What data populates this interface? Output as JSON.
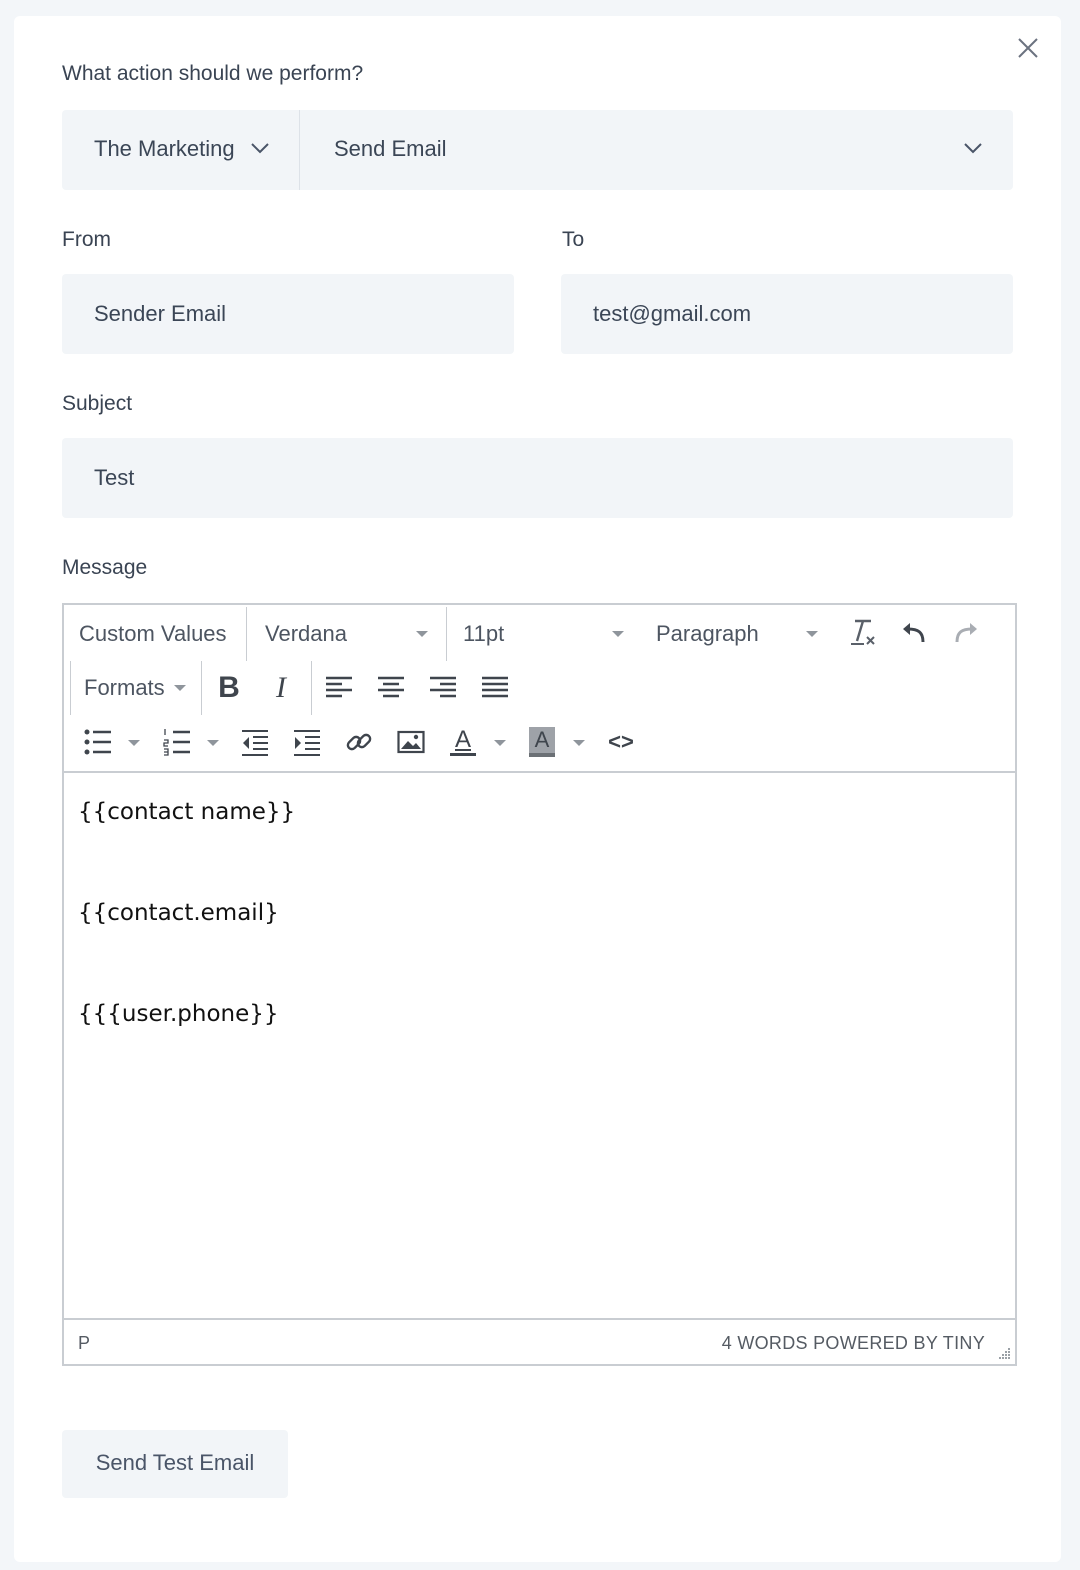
{
  "question": "What action should we perform?",
  "action": {
    "app_label": "The Marketing",
    "type_label": "Send Email"
  },
  "from": {
    "label": "From",
    "value": "Sender Email"
  },
  "to": {
    "label": "To",
    "value": "test@gmail.com"
  },
  "subject": {
    "label": "Subject",
    "value": "Test"
  },
  "message": {
    "label": "Message",
    "toolbar": {
      "custom_values": "Custom Values",
      "font_family": "Verdana",
      "font_size": "11pt",
      "block_format": "Paragraph",
      "formats": "Formats",
      "bold": "B",
      "italic": "I",
      "text_color_glyph": "A",
      "highlight_glyph": "A",
      "code_glyph": "<>"
    },
    "lines": [
      "{{contact name}}",
      "{{contact.email}",
      "{{{user.phone}}"
    ],
    "status_path": "P",
    "word_count": "4 WORDS POWERED BY TINY"
  },
  "send_test_button": "Send Test Email",
  "colors": {
    "field_bg": "#f2f5f8",
    "page_bg": "#f3f6f9",
    "text": "#3b4656",
    "editor_border": "#c9cdd2"
  }
}
